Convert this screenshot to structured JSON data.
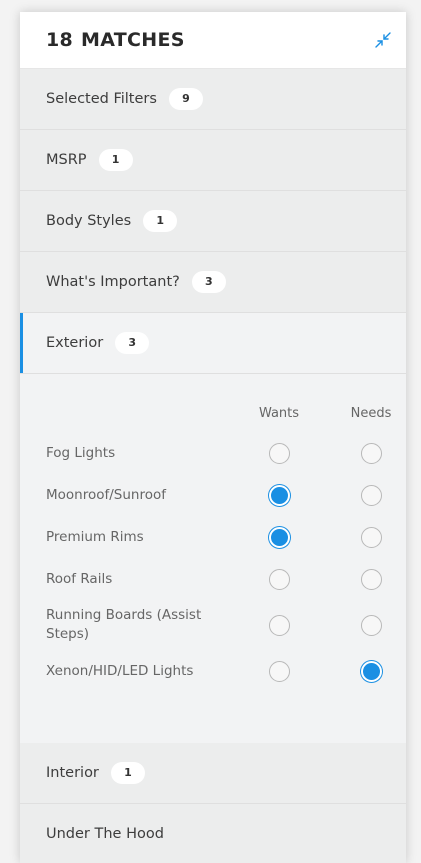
{
  "header": {
    "count": "18",
    "label": "MATCHES",
    "collapse_icon": "collapse-arrows-icon"
  },
  "sections_top": [
    {
      "label": "Selected Filters",
      "badge": "9"
    },
    {
      "label": "MSRP",
      "badge": "1"
    },
    {
      "label": "Body Styles",
      "badge": "1"
    },
    {
      "label": "What's Important?",
      "badge": "3"
    }
  ],
  "exterior": {
    "label": "Exterior",
    "badge": "3",
    "col_wants": "Wants",
    "col_needs": "Needs",
    "options": [
      {
        "label": "Fog Lights",
        "wants": false,
        "needs": false
      },
      {
        "label": "Moonroof/Sunroof",
        "wants": true,
        "needs": false
      },
      {
        "label": "Premium Rims",
        "wants": true,
        "needs": false
      },
      {
        "label": "Roof Rails",
        "wants": false,
        "needs": false
      },
      {
        "label": "Running Boards (Assist Steps)",
        "wants": false,
        "needs": false
      },
      {
        "label": "Xenon/HID/LED Lights",
        "wants": false,
        "needs": true
      }
    ]
  },
  "sections_bottom": [
    {
      "label": "Interior",
      "badge": "1"
    },
    {
      "label": "Under The Hood",
      "badge": ""
    }
  ],
  "colors": {
    "accent": "#1a8fe3"
  }
}
